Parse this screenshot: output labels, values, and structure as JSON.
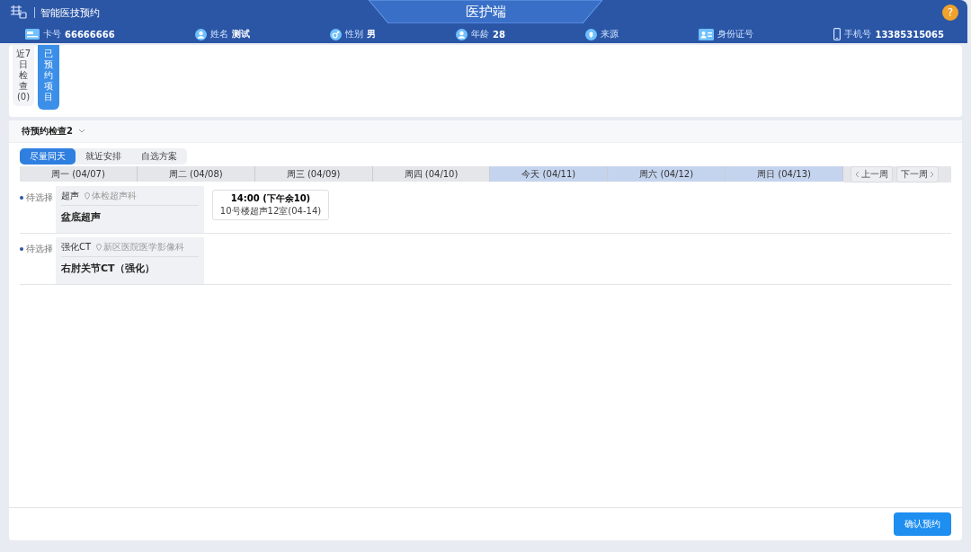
{
  "header": {
    "app_title": "智能医技预约",
    "center_title": "医护端",
    "help": "?"
  },
  "patient": [
    {
      "kind": "card",
      "label": "卡号",
      "value": "66666666"
    },
    {
      "kind": "person",
      "label": "姓名",
      "value": "测试"
    },
    {
      "kind": "gender",
      "label": "性别",
      "value": "男"
    },
    {
      "kind": "person",
      "label": "年龄",
      "value": "28"
    },
    {
      "kind": "pin",
      "label": "来源"
    },
    {
      "kind": "id",
      "label": "身份证号"
    },
    {
      "kind": "phone",
      "label": "手机号",
      "value": "13385315065"
    }
  ],
  "side_tabs": [
    {
      "label": "近7日检查(0)",
      "selected": false
    },
    {
      "label": "已预约项目",
      "selected": true
    }
  ],
  "section": {
    "title": "待预约检查2"
  },
  "modes": [
    {
      "label": "尽量同天",
      "selected": true
    },
    {
      "label": "就近安排",
      "selected": false
    },
    {
      "label": "自选方案",
      "selected": false
    }
  ],
  "week": [
    {
      "label": "周一 (04/07)",
      "highlighted": false
    },
    {
      "label": "周二 (04/08)",
      "highlighted": false
    },
    {
      "label": "周三 (04/09)",
      "highlighted": false
    },
    {
      "label": "周四 (04/10)",
      "highlighted": false
    },
    {
      "label": "今天 (04/11)",
      "highlighted": true
    },
    {
      "label": "周六 (04/12)",
      "highlighted": true
    },
    {
      "label": "周日 (04/13)",
      "highlighted": true
    }
  ],
  "week_nav": {
    "prev": "上一周",
    "next": "下一周"
  },
  "exams": [
    {
      "status": "待选择",
      "type": "超声",
      "location": "体检超声科",
      "name": "盆底超声",
      "slots": [
        {
          "time": "14:00 (下午余10)",
          "room": "10号楼超声12室(04-14)"
        }
      ]
    },
    {
      "status": "待选择",
      "type": "强化CT",
      "location": "新区医院医学影像科",
      "name": "右肘关节CT（强化）"
    }
  ],
  "confirm": "确认预约"
}
